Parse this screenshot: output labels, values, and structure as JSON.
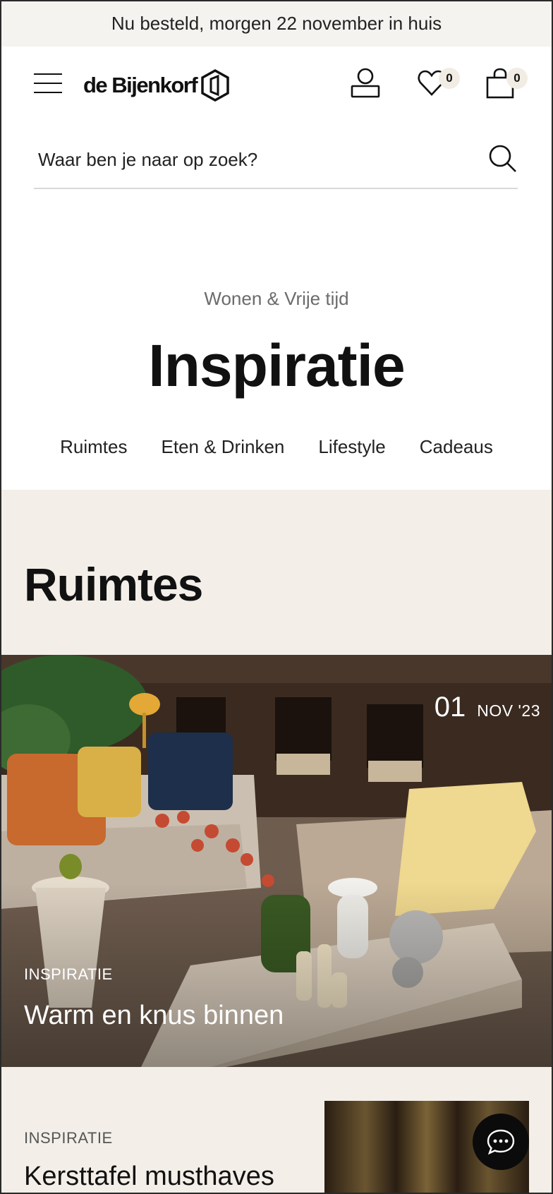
{
  "promo": {
    "text": "Nu besteld, morgen 22 november in huis"
  },
  "header": {
    "logo_text": "de Bijenkorf",
    "wishlist_count": "0",
    "cart_count": "0"
  },
  "search": {
    "placeholder": "Waar ben je naar op zoek?"
  },
  "hero": {
    "kicker": "Wonen & Vrije tijd",
    "title": "Inspiratie",
    "tabs": [
      {
        "label": "Ruimtes"
      },
      {
        "label": "Eten & Drinken"
      },
      {
        "label": "Lifestyle"
      },
      {
        "label": "Cadeaus"
      }
    ]
  },
  "section": {
    "title": "Ruimtes",
    "featured": {
      "day": "01",
      "month_year": "NOV '23",
      "category": "INSPIRATIE",
      "headline": "Warm en knus binnen"
    },
    "second": {
      "category": "INSPIRATIE",
      "headline": "Kersttafel musthaves"
    }
  },
  "icons": {
    "menu": "hamburger-icon",
    "account": "user-icon",
    "wishlist": "heart-icon",
    "cart": "shopping-bag-icon",
    "search": "search-icon",
    "chat": "chat-icon"
  },
  "colors": {
    "promo_bg": "#f5f3ef",
    "section_bg": "#f3eee8",
    "badge_bg": "#f1ece4",
    "chat_bg": "#0b0b0b"
  }
}
